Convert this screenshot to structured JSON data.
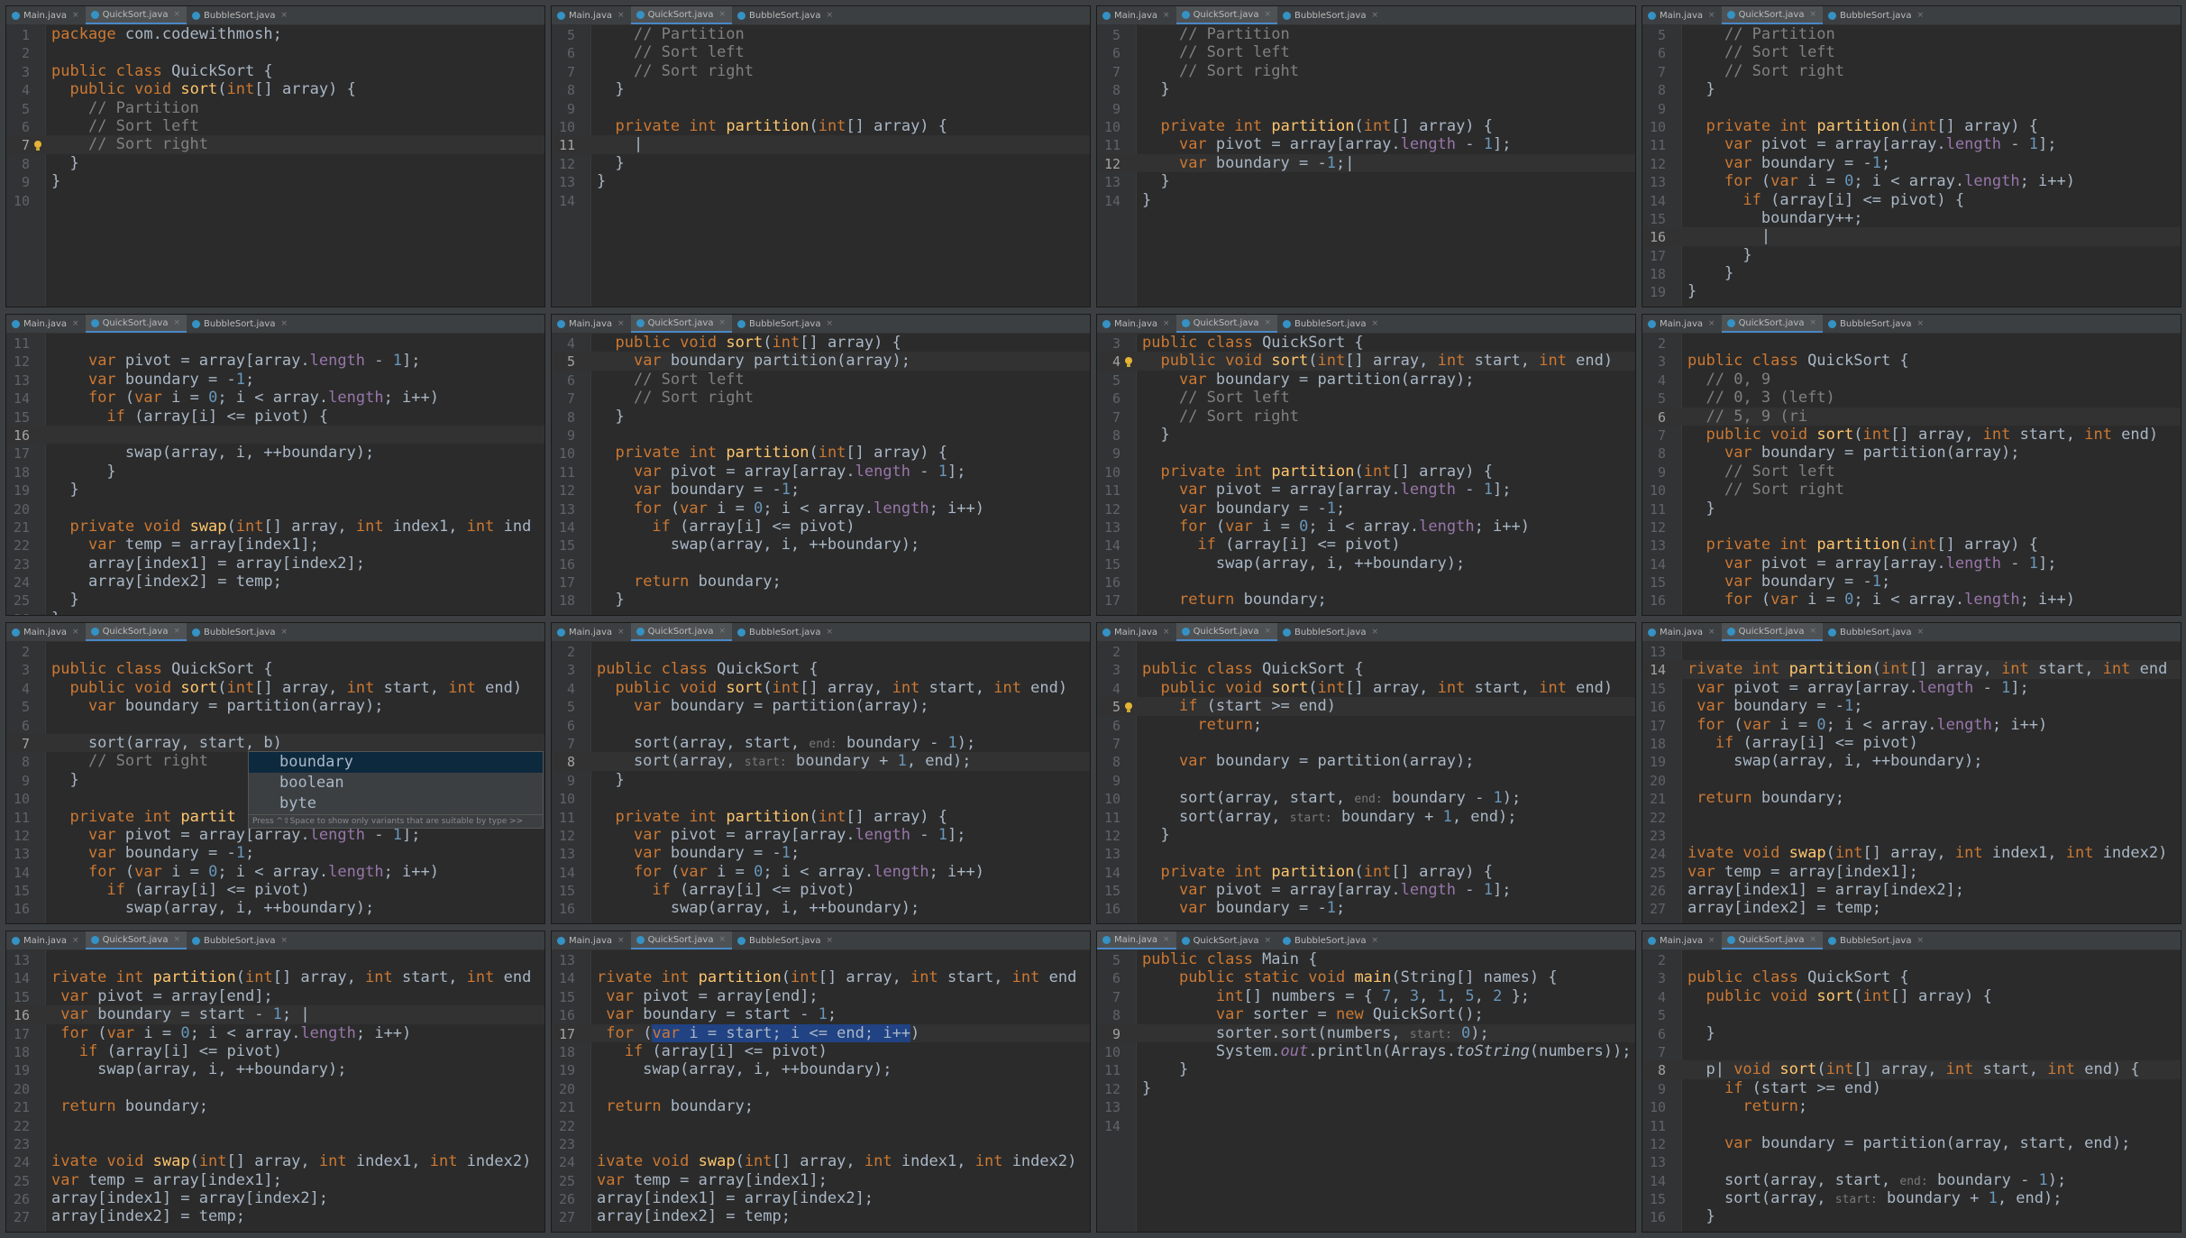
{
  "tabs": [
    "Main.java",
    "QuickSort.java",
    "BubbleSort.java"
  ],
  "panels": [
    {
      "active": 1,
      "start": 1,
      "cur": 7,
      "bulb": 7,
      "lines": [
        "<span class=\"k\">package</span> com.codewithmosh;",
        "",
        "<span class=\"k\">public class</span> QuickSort {",
        "  <span class=\"k\">public void</span> <span class=\"f\">sort</span>(<span class=\"k\">int</span>[] array) {",
        "    <span class=\"c\">// Partition</span>",
        "    <span class=\"c\">// Sort left</span>",
        "    <span class=\"c\">// Sort right</span>",
        "  }",
        "}",
        ""
      ]
    },
    {
      "active": 1,
      "start": 5,
      "cur": 11,
      "lines": [
        "    <span class=\"c\">// Partition</span>",
        "    <span class=\"c\">// Sort left</span>",
        "    <span class=\"c\">// Sort right</span>",
        "  }",
        "",
        "  <span class=\"k\">private int</span> <span class=\"f\">partition</span>(<span class=\"k\">int</span>[] array) {",
        "    |",
        "  }",
        "}",
        ""
      ]
    },
    {
      "active": 1,
      "start": 5,
      "cur": 12,
      "lines": [
        "    <span class=\"c\">// Partition</span>",
        "    <span class=\"c\">// Sort left</span>",
        "    <span class=\"c\">// Sort right</span>",
        "  }",
        "",
        "  <span class=\"k\">private int</span> <span class=\"f\">partition</span>(<span class=\"k\">int</span>[] array) {",
        "    <span class=\"k\">var</span> pivot = array[array.<span class=\"pf\">length</span> - <span class=\"n\">1</span>];",
        "    <span class=\"k\">var</span> boundary = -<span class=\"n\">1</span>;|",
        "  }",
        "}"
      ]
    },
    {
      "active": 1,
      "start": 5,
      "cur": 16,
      "lines": [
        "    <span class=\"c\">// Partition</span>",
        "    <span class=\"c\">// Sort left</span>",
        "    <span class=\"c\">// Sort right</span>",
        "  }",
        "",
        "  <span class=\"k\">private int</span> <span class=\"f\">partition</span>(<span class=\"k\">int</span>[] array) {",
        "    <span class=\"k\">var</span> pivot = array[array.<span class=\"pf\">length</span> - <span class=\"n\">1</span>];",
        "    <span class=\"k\">var</span> boundary = -<span class=\"n\">1</span>;",
        "    <span class=\"k\">for</span> (<span class=\"k\">var</span> i = <span class=\"n\">0</span>; i &lt; array.<span class=\"pf\">length</span>; i++)",
        "      <span class=\"k\">if</span> (array[i] &lt;= pivot) {",
        "        boundary++;",
        "        |",
        "      }",
        "    }",
        "}"
      ]
    },
    {
      "active": 1,
      "start": 11,
      "cur": 16,
      "lines": [
        "",
        "    <span class=\"k\">var</span> pivot = array[array.<span class=\"pf\">length</span> - <span class=\"n\">1</span>];",
        "    <span class=\"k\">var</span> boundary = -<span class=\"n\">1</span>;",
        "    <span class=\"k\">for</span> (<span class=\"k\">var</span> i = <span class=\"n\">0</span>; i &lt; array.<span class=\"pf\">length</span>; i++)",
        "      <span class=\"k\">if</span> (array[i] &lt;= pivot) {",
        "",
        "        swap(array, i, ++boundary);",
        "      }",
        "  }",
        "",
        "  <span class=\"k\">private void</span> <span class=\"f\">swap</span>(<span class=\"k\">int</span>[] array, <span class=\"k\">int</span> index1, <span class=\"k\">int</span> ind",
        "    <span class=\"k\">var</span> temp = array[index1];",
        "    array[index1] = array[index2];",
        "    array[index2] = temp;",
        "  }",
        "}"
      ]
    },
    {
      "active": 1,
      "start": 4,
      "cur": 5,
      "lines": [
        "  <span class=\"k\">public void</span> <span class=\"f\">sort</span>(<span class=\"k\">int</span>[] array) {",
        "    <span class=\"k\">var</span> boundary partition(array);",
        "    <span class=\"c\">// Sort left</span>",
        "    <span class=\"c\">// Sort right</span>",
        "  }",
        "",
        "  <span class=\"k\">private int</span> <span class=\"f\">partition</span>(<span class=\"k\">int</span>[] array) {",
        "    <span class=\"k\">var</span> pivot = array[array.<span class=\"pf\">length</span> - <span class=\"n\">1</span>];",
        "    <span class=\"k\">var</span> boundary = -<span class=\"n\">1</span>;",
        "    <span class=\"k\">for</span> (<span class=\"k\">var</span> i = <span class=\"n\">0</span>; i &lt; array.<span class=\"pf\">length</span>; i++)",
        "      <span class=\"k\">if</span> (array[i] &lt;= pivot)",
        "        swap(array, i, ++boundary);",
        "",
        "    <span class=\"k\">return</span> boundary;",
        "  }"
      ]
    },
    {
      "active": 1,
      "start": 3,
      "cur": 4,
      "bulb": 4,
      "lines": [
        "<span class=\"k\">public class</span> QuickSort {",
        "  <span class=\"k\">public void</span> <span class=\"f\">sort</span>(<span class=\"k\">int</span>[] array, <span class=\"k\">int</span> start, <span class=\"k\">int</span> end)",
        "    <span class=\"k\">var</span> boundary = partition(array);",
        "    <span class=\"c\">// Sort left</span>",
        "    <span class=\"c\">// Sort right</span>",
        "  }",
        "",
        "  <span class=\"k\">private int</span> <span class=\"f\">partition</span>(<span class=\"k\">int</span>[] array) {",
        "    <span class=\"k\">var</span> pivot = array[array.<span class=\"pf\">length</span> - <span class=\"n\">1</span>];",
        "    <span class=\"k\">var</span> boundary = -<span class=\"n\">1</span>;",
        "    <span class=\"k\">for</span> (<span class=\"k\">var</span> i = <span class=\"n\">0</span>; i &lt; array.<span class=\"pf\">length</span>; i++)",
        "      <span class=\"k\">if</span> (array[i] &lt;= pivot)",
        "        swap(array, i, ++boundary);",
        "",
        "    <span class=\"k\">return</span> boundary;"
      ]
    },
    {
      "active": 1,
      "start": 2,
      "cur": 6,
      "lines": [
        "",
        "<span class=\"k\">public class</span> QuickSort {",
        "  <span class=\"c\">// 0, 9</span>",
        "  <span class=\"c\">// 0, 3 (left)</span>",
        "  <span class=\"c\">// 5, 9 (ri</span>",
        "  <span class=\"k\">public void</span> <span class=\"f\">sort</span>(<span class=\"k\">int</span>[] array, <span class=\"k\">int</span> start, <span class=\"k\">int</span> end)",
        "    <span class=\"k\">var</span> boundary = partition(array);",
        "    <span class=\"c\">// Sort left</span>",
        "    <span class=\"c\">// Sort right</span>",
        "  }",
        "",
        "  <span class=\"k\">private int</span> <span class=\"f\">partition</span>(<span class=\"k\">int</span>[] array) {",
        "    <span class=\"k\">var</span> pivot = array[array.<span class=\"pf\">length</span> - <span class=\"n\">1</span>];",
        "    <span class=\"k\">var</span> boundary = -<span class=\"n\">1</span>;",
        "    <span class=\"k\">for</span> (<span class=\"k\">var</span> i = <span class=\"n\">0</span>; i &lt; array.<span class=\"pf\">length</span>; i++)"
      ]
    },
    {
      "active": 1,
      "start": 2,
      "cur": 7,
      "lines": [
        "",
        "<span class=\"k\">public class</span> QuickSort {",
        "  <span class=\"k\">public void</span> <span class=\"f\">sort</span>(<span class=\"k\">int</span>[] array, <span class=\"k\">int</span> start, <span class=\"k\">int</span> end)",
        "    <span class=\"k\">var</span> boundary = partition(array);",
        "",
        "    sort(array, start, b)",
        "    <span class=\"c\">// Sort right</span>",
        "  }",
        "",
        "  <span class=\"k\">private int</span> <span class=\"f\">partit</span>",
        "    <span class=\"k\">var</span> pivot = array[array.<span class=\"pf\">length</span> - <span class=\"n\">1</span>];",
        "    <span class=\"k\">var</span> boundary = -<span class=\"n\">1</span>;",
        "    <span class=\"k\">for</span> (<span class=\"k\">var</span> i = <span class=\"n\">0</span>; i &lt; array.<span class=\"pf\">length</span>; i++)",
        "      <span class=\"k\">if</span> (array[i] &lt;= pivot)",
        "        swap(array, i, ++boundary);"
      ]
    },
    {
      "active": 1,
      "start": 2,
      "cur": 8,
      "lines": [
        "",
        "<span class=\"k\">public class</span> QuickSort {",
        "  <span class=\"k\">public void</span> <span class=\"f\">sort</span>(<span class=\"k\">int</span>[] array, <span class=\"k\">int</span> start, <span class=\"k\">int</span> end)",
        "    <span class=\"k\">var</span> boundary = partition(array);",
        "",
        "    sort(array, start, <span class=\"h\">end:</span> boundary - <span class=\"n\">1</span>);",
        "    sort(array, <span class=\"h\">start:</span> boundary + <span class=\"n\">1</span>, end);",
        "  }",
        "",
        "  <span class=\"k\">private int</span> <span class=\"f\">partition</span>(<span class=\"k\">int</span>[] array) {",
        "    <span class=\"k\">var</span> pivot = array[array.<span class=\"pf\">length</span> - <span class=\"n\">1</span>];",
        "    <span class=\"k\">var</span> boundary = -<span class=\"n\">1</span>;",
        "    <span class=\"k\">for</span> (<span class=\"k\">var</span> i = <span class=\"n\">0</span>; i &lt; array.<span class=\"pf\">length</span>; i++)",
        "      <span class=\"k\">if</span> (array[i] &lt;= pivot)",
        "        swap(array, i, ++boundary);"
      ]
    },
    {
      "active": 1,
      "start": 2,
      "cur": 5,
      "bulb": 5,
      "lines": [
        "",
        "<span class=\"k\">public class</span> QuickSort {",
        "  <span class=\"k\">public void</span> <span class=\"f\">sort</span>(<span class=\"k\">int</span>[] array, <span class=\"k\">int</span> start, <span class=\"k\">int</span> end)",
        "    <span class=\"k\">if</span> (start &gt;= end)",
        "      <span class=\"k\">return</span>;",
        "",
        "    <span class=\"k\">var</span> boundary = partition(array);",
        "",
        "    sort(array, start, <span class=\"h\">end:</span> boundary - <span class=\"n\">1</span>);",
        "    sort(array, <span class=\"h\">start:</span> boundary + <span class=\"n\">1</span>, end);",
        "  }",
        "",
        "  <span class=\"k\">private int</span> <span class=\"f\">partition</span>(<span class=\"k\">int</span>[] array) {",
        "    <span class=\"k\">var</span> pivot = array[array.<span class=\"pf\">length</span> - <span class=\"n\">1</span>];",
        "    <span class=\"k\">var</span> boundary = -<span class=\"n\">1</span>;"
      ]
    },
    {
      "active": 1,
      "start": 13,
      "cur": 14,
      "lines": [
        "",
        "<span class=\"k\">rivate int</span> <span class=\"f\">partition</span>(<span class=\"k\">int</span>[] array, <span class=\"k\">int</span> start, <span class=\"k\">int</span> end",
        " <span class=\"k\">var</span> pivot = array[array.<span class=\"pf\">length</span> - <span class=\"n\">1</span>];",
        " <span class=\"k\">var</span> boundary = -<span class=\"n\">1</span>;",
        " <span class=\"k\">for</span> (<span class=\"k\">var</span> i = <span class=\"n\">0</span>; i &lt; array.<span class=\"pf\">length</span>; i++)",
        "   <span class=\"k\">if</span> (array[i] &lt;= pivot)",
        "     swap(array, i, ++boundary);",
        "",
        " <span class=\"k\">return</span> boundary;",
        "",
        "",
        "<span class=\"k\">ivate void</span> <span class=\"f\">swap</span>(<span class=\"k\">int</span>[] array, <span class=\"k\">int</span> index1, <span class=\"k\">int</span> index2)",
        "<span class=\"k\">var</span> temp = array[index1];",
        "array[index1] = array[index2];",
        "array[index2] = temp;"
      ]
    },
    {
      "active": 1,
      "start": 13,
      "cur": 16,
      "lines": [
        "",
        "<span class=\"k\">rivate int</span> <span class=\"f\">partition</span>(<span class=\"k\">int</span>[] array, <span class=\"k\">int</span> start, <span class=\"k\">int</span> end",
        " <span class=\"k\">var</span> pivot = array[end];",
        " <span class=\"k\">var</span> boundary = start - <span class=\"n\">1</span>; |",
        " <span class=\"k\">for</span> (<span class=\"k\">var</span> i = <span class=\"n\">0</span>; i &lt; array.<span class=\"pf\">length</span>; i++)",
        "   <span class=\"k\">if</span> (array[i] &lt;= pivot)",
        "     swap(array, i, ++boundary);",
        "",
        " <span class=\"k\">return</span> boundary;",
        "",
        "",
        "<span class=\"k\">ivate void</span> <span class=\"f\">swap</span>(<span class=\"k\">int</span>[] array, <span class=\"k\">int</span> index1, <span class=\"k\">int</span> index2)",
        "<span class=\"k\">var</span> temp = array[index1];",
        "array[index1] = array[index2];",
        "array[index2] = temp;"
      ]
    },
    {
      "active": 1,
      "start": 13,
      "cur": 17,
      "lines": [
        "",
        "<span class=\"k\">rivate int</span> <span class=\"f\">partition</span>(<span class=\"k\">int</span>[] array, <span class=\"k\">int</span> start, <span class=\"k\">int</span> end",
        " <span class=\"k\">var</span> pivot = array[end];",
        " <span class=\"k\">var</span> boundary = start - <span class=\"n\">1</span>;",
        " <span class=\"k\">for</span> (<span style=\"background:#214283\"><span class=\"k\">var</span> i = start; i &lt;= end; i++</span>)",
        "   <span class=\"k\">if</span> (array[i] &lt;= pivot)",
        "     swap(array, i, ++boundary);",
        "",
        " <span class=\"k\">return</span> boundary;",
        "",
        "",
        "<span class=\"k\">ivate void</span> <span class=\"f\">swap</span>(<span class=\"k\">int</span>[] array, <span class=\"k\">int</span> index1, <span class=\"k\">int</span> index2)",
        "<span class=\"k\">var</span> temp = array[index1];",
        "array[index1] = array[index2];",
        "array[index2] = temp;"
      ]
    },
    {
      "active": 0,
      "start": 5,
      "cur": 9,
      "lines": [
        "<span class=\"k\">public class</span> Main {",
        "    <span class=\"k\">public static void</span> <span class=\"f\">main</span>(String[] names) {",
        "        <span class=\"k\">int</span>[] numbers = { <span class=\"n\">7</span>, <span class=\"n\">3</span>, <span class=\"n\">1</span>, <span class=\"n\">5</span>, <span class=\"n\">2</span> };",
        "        <span class=\"k\">var</span> sorter = <span class=\"k\">new</span> QuickSort();",
        "        sorter.sort(numbers, <span class=\"h\">start:</span> <span class=\"n\">0</span>);",
        "        System.<span class=\"pf it\">out</span>.println(Arrays.<span class=\"it\">toString</span>(numbers));",
        "    }",
        "}",
        "",
        ""
      ]
    },
    {
      "active": 1,
      "start": 2,
      "cur": 8,
      "lines": [
        "",
        "<span class=\"k\">public class</span> QuickSort {",
        "  <span class=\"k\">public void</span> <span class=\"f\">sort</span>(<span class=\"k\">int</span>[] array) {",
        "",
        "  }",
        "",
        "  p| <span class=\"k\">void</span> <span class=\"f\">sort</span>(<span class=\"k\">int</span>[] array, <span class=\"k\">int</span> start, <span class=\"k\">int</span> end) {",
        "    <span class=\"k\">if</span> (start &gt;= end)",
        "      <span class=\"k\">return</span>;",
        "",
        "    <span class=\"k\">var</span> boundary = partition(array, start, end);",
        "",
        "    sort(array, start, <span class=\"h\">end:</span> boundary - <span class=\"n\">1</span>);",
        "    sort(array, <span class=\"h\">start:</span> boundary + <span class=\"n\">1</span>, end);",
        "  }"
      ]
    }
  ],
  "completion": {
    "items": [
      "boundary",
      "boolean",
      "byte"
    ],
    "hint": "Press ^⇧Space to show only variants that are suitable by type  >>"
  }
}
